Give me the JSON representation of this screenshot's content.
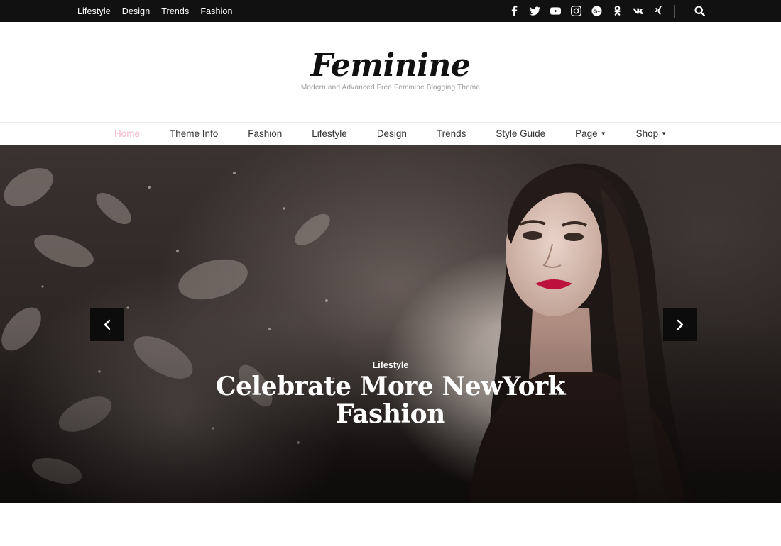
{
  "topbar": {
    "links": [
      "Lifestyle",
      "Design",
      "Trends",
      "Fashion"
    ],
    "social_icons": [
      "facebook-icon",
      "twitter-icon",
      "youtube-icon",
      "instagram-icon",
      "google-plus-icon",
      "odnoklassniki-icon",
      "vk-icon",
      "xing-icon"
    ],
    "search_icon": "search-icon"
  },
  "branding": {
    "title": "Feminine",
    "description": "Modern and Advanced Free Feminine Blogging Theme"
  },
  "nav": {
    "items": [
      "Home",
      "Theme Info",
      "Fashion",
      "Lifestyle",
      "Design",
      "Trends",
      "Style Guide",
      "Page",
      "Shop"
    ],
    "active_color": "#f2b8cf"
  },
  "hero": {
    "category": "Lifestyle",
    "title": "Celebrate More NewYork Fashion",
    "prev_icon": "chevron-left-icon",
    "next_icon": "chevron-right-icon"
  }
}
